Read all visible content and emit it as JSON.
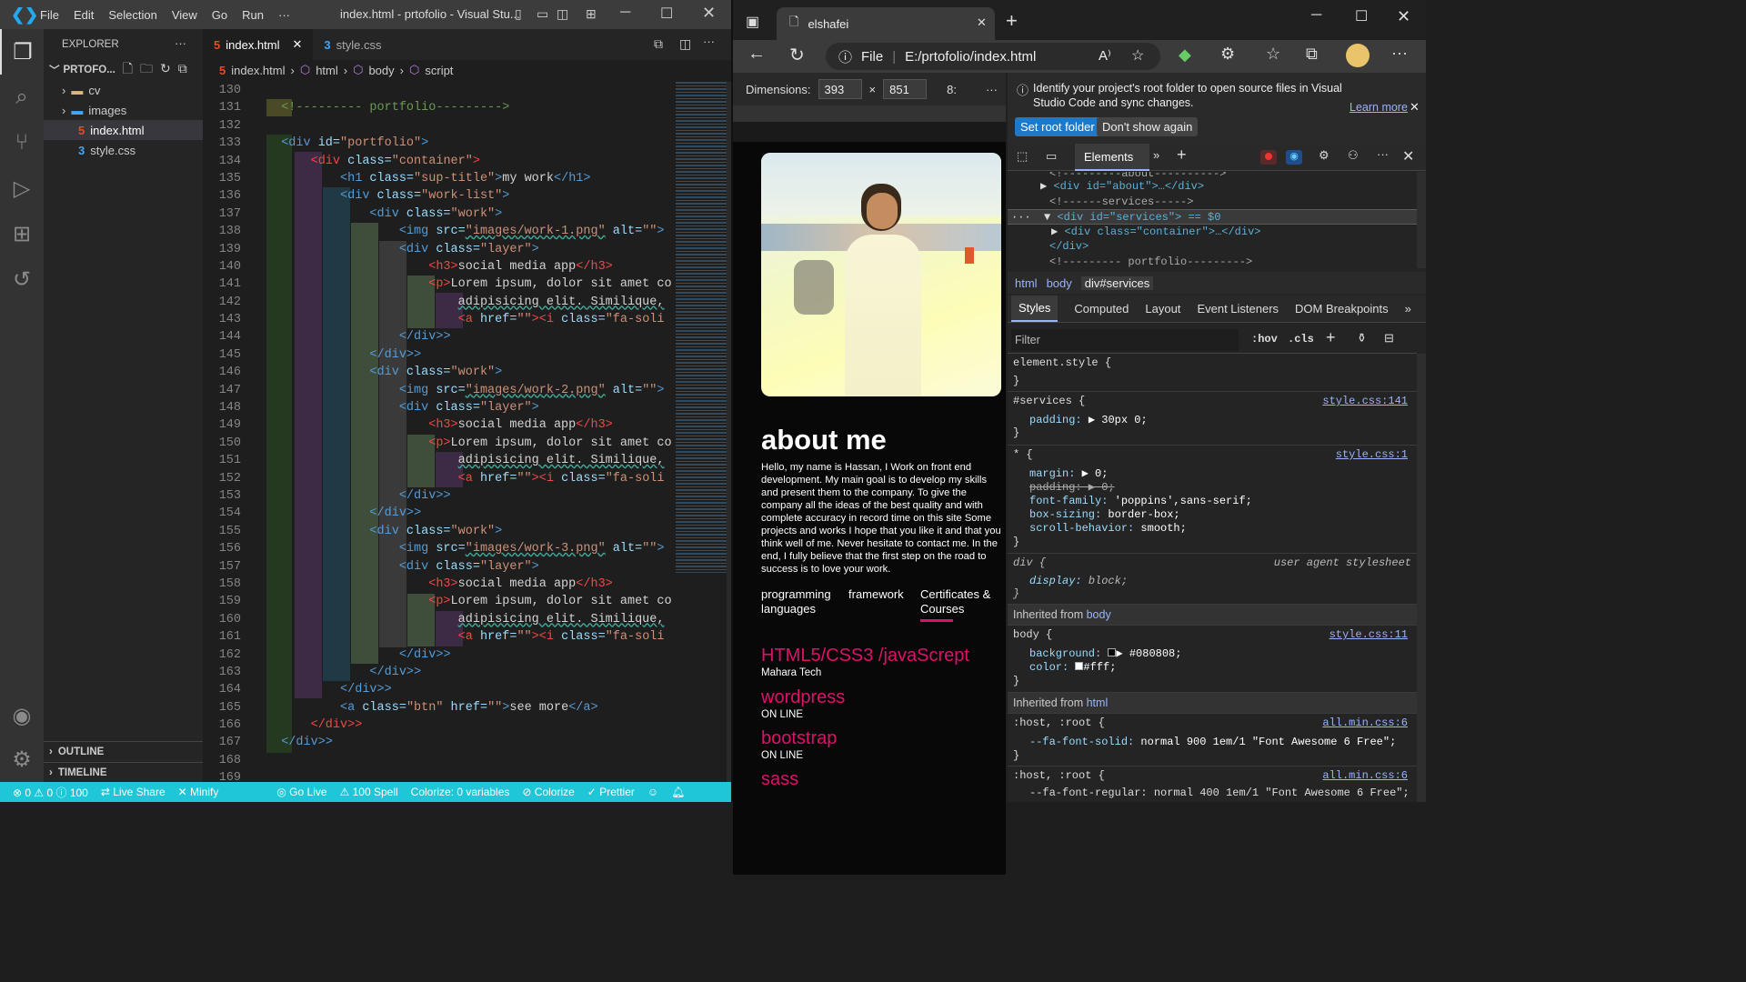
{
  "vscode": {
    "menu": [
      "File",
      "Edit",
      "Selection",
      "View",
      "Go",
      "Run",
      "···"
    ],
    "title": "index.html - prtofolio - Visual Stu...",
    "explorer": {
      "title": "EXPLORER",
      "folder": "PRTOFO...",
      "items": [
        "cv",
        "images",
        "index.html",
        "style.css"
      ],
      "outline": "OUTLINE",
      "timeline": "TIMELINE"
    },
    "tabs": [
      "index.html",
      "style.css"
    ],
    "breadcrumb": [
      "index.html",
      "html",
      "body",
      "script"
    ],
    "line_numbers": [
      "130",
      "131",
      "132",
      "133",
      "134",
      "135",
      "136",
      "137",
      "138",
      "139",
      "140",
      "141",
      "142",
      "143",
      "144",
      "145",
      "146",
      "147",
      "148",
      "149",
      "150",
      "151",
      "152",
      "153",
      "154",
      "155",
      "156",
      "157",
      "158",
      "159",
      "160",
      "161",
      "162",
      "163",
      "164",
      "165",
      "166",
      "167",
      "168",
      "169"
    ],
    "status": [
      "⊗ 0 ⚠ 0 ⓘ 100",
      "Live Share",
      "Minify",
      "Go Live",
      "⚠ 100 Spell",
      "Colorize: 0 variables",
      "Colorize",
      "Prettier"
    ]
  },
  "code": {
    "c131": "<!--------- portfolio--------->",
    "div_open": "<div",
    "div_close": "</div>",
    "div_close2": ">",
    "id_attr": " id=",
    "portfolio_val": "\"portfolio\"",
    "class_attr": " class=",
    "container_val": "\"container\"",
    "h1_open": "<h1",
    "suptitle_val": "\"sup-title\"",
    "my_work": "my work",
    "h1_close": "</h1>",
    "worklist_val": "\"work-list\"",
    "work_val": "\"work\"",
    "img_open": "<img",
    "src_attr": " src=",
    "work1": "\"images/work-1.png\"",
    "work2": "\"images/work-2.png\"",
    "work3": "\"images/work-3.png\"",
    "alt_attr": " alt=",
    "alt_val": "\"\"",
    "gt": ">",
    "layer_val": "\"layer\"",
    "h3_open": "<h3>",
    "social": "social media app",
    "h3_close": "</h3>",
    "p_open": "<p>",
    "lorem": "Lorem ipsum, dolor sit amet co",
    "adip": "adipisicing elit. Similique,",
    "a_open": "<a",
    "href_attr": " href=",
    "href_val": "\"\"",
    "i_open": "<i",
    "fa_val": "\"fa-soli",
    "btn_val": "\"btn\"",
    "see_more": "see more",
    "a_close": "</a>"
  },
  "browser": {
    "tab_title": "elshafei",
    "url_prefix": "File",
    "url": "E:/prtofolio/index.html",
    "dim_label": "Dimensions:",
    "width": "393",
    "height": "851",
    "times": "×",
    "zoom": "8:"
  },
  "page": {
    "about_title": "about me",
    "about_text": "Hello, my name is Hassan, I Work on front end development. My main goal is to develop my skills and present them to the company. To give the company all the ideas of the best quality and with complete accuracy in record time on this site Some projects and works I hope that you like it and that you think well of me. Never hesitate to contact me. In the end, I fully believe that the first step on the road to success is to love your work.",
    "tabs": [
      "programming languages",
      "framework",
      "Certificates & Courses"
    ],
    "skills": [
      {
        "name": "HTML5/CSS3 /javaScrept",
        "sub": "Mahara Tech"
      },
      {
        "name": "wordpress",
        "sub": "ON LINE"
      },
      {
        "name": "bootstrap",
        "sub": "ON LINE"
      },
      {
        "name": "sass",
        "sub": ""
      }
    ]
  },
  "devtools": {
    "banner": "Identify your project's root folder to open source files in Visual Studio Code and sync changes.",
    "learn_more": "Learn more",
    "btn_root": "Set root folder",
    "btn_dont": "Don't show again",
    "tab_elements": "Elements",
    "dom": [
      "<!---------about---------->",
      "<div id=\"about\">…</div>",
      "<!------services----->",
      "<div id=\"services\"> == $0",
      "<div class=\"container\">…</div>",
      "</div>",
      "<!--------- portfolio--------->"
    ],
    "path": [
      "html",
      "body",
      "div#services"
    ],
    "style_tabs": [
      "Styles",
      "Computed",
      "Layout",
      "Event Listeners",
      "DOM Breakpoints"
    ],
    "filter": "Filter",
    "hov": ":hov",
    "cls": ".cls",
    "rules": {
      "element_style": "element.style {",
      "close": "}",
      "services_sel": "#services {",
      "services_src": "style.css:141",
      "padding": "padding:",
      "padding_val": "▶ 30px 0;",
      "star_sel": "* {",
      "star_src": "style.css:1",
      "margin": "margin:",
      "margin_val": "▶ 0;",
      "padding_struck": "padding: ▶ 0;",
      "font": "font-family:",
      "font_val": "'poppins',sans-serif;",
      "box": "box-sizing:",
      "box_val": "border-box;",
      "scroll": "scroll-behavior:",
      "scroll_val": "smooth;",
      "div_sel": "div {",
      "ua": "user agent stylesheet",
      "display": "display:",
      "display_val": "block;",
      "inh_body": "Inherited from",
      "inh_body_tag": "body",
      "body_sel": "body {",
      "body_src": "style.css:11",
      "bg": "background:",
      "bg_val": "▶ #080808;",
      "color": "color:",
      "color_val": "#fff;",
      "inh_html_tag": "html",
      "host_sel": ":host, :root {",
      "host_src": "all.min.css:6",
      "fa_solid": "--fa-font-solid:",
      "fa_solid_val": "normal 900 1em/1 \"Font Awesome 6 Free\";",
      "fa_regular": "--fa-font-regular: normal 400 1em/1 \"Font Awesome 6 Free\";"
    }
  },
  "colors": {
    "accent_pink": "#e0106a",
    "status_bar": "#1ec6d8",
    "vscode_blue": "#007acc"
  }
}
